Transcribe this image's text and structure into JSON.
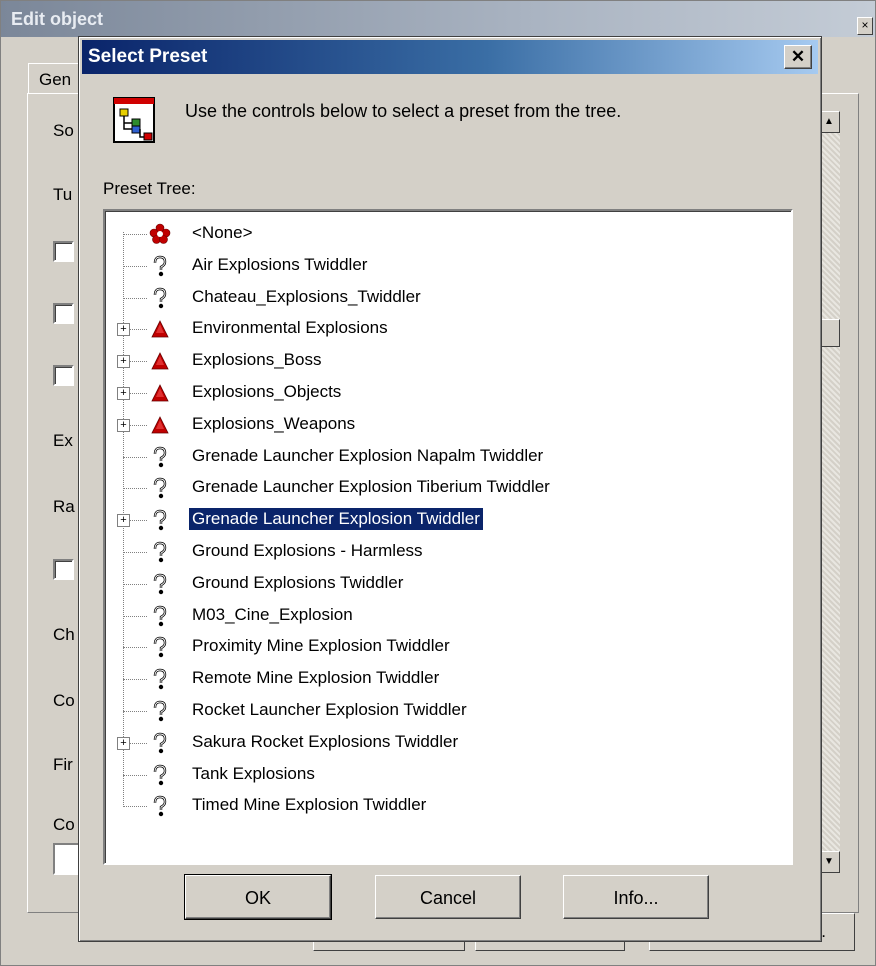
{
  "background_window": {
    "title": "Edit object",
    "close_glyph": "×",
    "tab_label": "Gen",
    "labels": [
      "So",
      "Tu",
      "Ex",
      "Ra",
      "Ch",
      "Co",
      "Fir",
      "Co"
    ],
    "bottom_button_fragment": "e..."
  },
  "dialog": {
    "title": "Select Preset",
    "close_glyph": "✕",
    "instruction": "Use the controls below to select a preset from the tree.",
    "tree_label": "Preset Tree:",
    "tree_items": [
      {
        "label": "<None>",
        "icon": "none-icon",
        "expandable": false,
        "selected": false
      },
      {
        "label": "Air Explosions Twiddler",
        "icon": "twiddler-icon",
        "expandable": false,
        "selected": false
      },
      {
        "label": "Chateau_Explosions_Twiddler",
        "icon": "twiddler-icon",
        "expandable": false,
        "selected": false
      },
      {
        "label": "Environmental Explosions",
        "icon": "explosion-icon",
        "expandable": true,
        "selected": false
      },
      {
        "label": "Explosions_Boss",
        "icon": "explosion-icon",
        "expandable": true,
        "selected": false
      },
      {
        "label": "Explosions_Objects",
        "icon": "explosion-icon",
        "expandable": true,
        "selected": false
      },
      {
        "label": "Explosions_Weapons",
        "icon": "explosion-icon",
        "expandable": true,
        "selected": false
      },
      {
        "label": "Grenade Launcher Explosion Napalm Twiddler",
        "icon": "twiddler-icon",
        "expandable": false,
        "selected": false
      },
      {
        "label": "Grenade Launcher Explosion Tiberium Twiddler",
        "icon": "twiddler-icon",
        "expandable": false,
        "selected": false
      },
      {
        "label": "Grenade Launcher Explosion Twiddler",
        "icon": "twiddler-icon",
        "expandable": true,
        "selected": true
      },
      {
        "label": "Ground Explosions - Harmless",
        "icon": "twiddler-icon",
        "expandable": false,
        "selected": false
      },
      {
        "label": "Ground Explosions Twiddler",
        "icon": "twiddler-icon",
        "expandable": false,
        "selected": false
      },
      {
        "label": "M03_Cine_Explosion",
        "icon": "twiddler-icon",
        "expandable": false,
        "selected": false
      },
      {
        "label": "Proximity Mine Explosion Twiddler",
        "icon": "twiddler-icon",
        "expandable": false,
        "selected": false
      },
      {
        "label": "Remote Mine Explosion Twiddler",
        "icon": "twiddler-icon",
        "expandable": false,
        "selected": false
      },
      {
        "label": "Rocket Launcher Explosion Twiddler",
        "icon": "twiddler-icon",
        "expandable": false,
        "selected": false
      },
      {
        "label": "Sakura Rocket Explosions Twiddler",
        "icon": "twiddler-icon",
        "expandable": true,
        "selected": false
      },
      {
        "label": "Tank Explosions",
        "icon": "twiddler-icon",
        "expandable": false,
        "selected": false
      },
      {
        "label": "Timed Mine Explosion Twiddler",
        "icon": "twiddler-icon",
        "expandable": false,
        "selected": false
      }
    ],
    "buttons": {
      "ok": "OK",
      "cancel": "Cancel",
      "info": "Info..."
    }
  },
  "colors": {
    "selection": "#0a246a",
    "active_title_start": "#0a246a",
    "explosion_red": "#c00000",
    "dialog_face": "#d4d0c8"
  }
}
